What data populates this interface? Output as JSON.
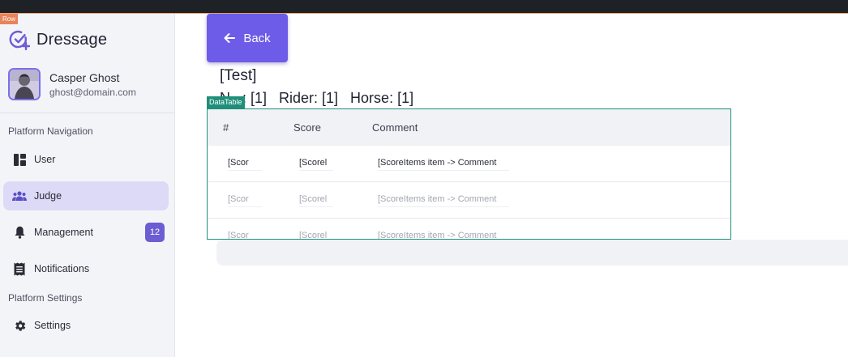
{
  "overlay_tags": {
    "row": "Row",
    "datatable": "DataTable"
  },
  "app": {
    "name": "Dressage",
    "logo_icon": "check-plus-circle-icon",
    "accent": "#6c5dd3"
  },
  "user": {
    "name": "Casper Ghost",
    "email": "ghost@domain.com"
  },
  "sidebar": {
    "sections": [
      {
        "title": "Platform Navigation",
        "items": [
          {
            "label": "User",
            "icon": "dashboard-icon",
            "active": false
          },
          {
            "label": "Judge",
            "icon": "people-icon",
            "active": true
          },
          {
            "label": "Management",
            "icon": "bell-icon",
            "badge": "12",
            "active": false
          },
          {
            "label": "Notifications",
            "icon": "receipt-icon",
            "active": false
          }
        ]
      },
      {
        "title": "Platform Settings",
        "items": [
          {
            "label": "Settings",
            "icon": "gear-icon",
            "active": false
          }
        ]
      }
    ]
  },
  "main": {
    "back_label": "Back",
    "test_title": "[Test]",
    "info_line": "N...: [1]   Rider: [1]   Horse: [1]"
  },
  "table": {
    "columns": [
      "#",
      "Score",
      "Comment"
    ],
    "rows": [
      [
        "[Scor",
        "[Scorel",
        "[ScoreItems item -> Comment"
      ],
      [
        "[Scor",
        "[Scorel",
        "[ScoreItems item -> Comment"
      ],
      [
        "[Scor",
        "[Scorel",
        "[ScoreItems item -> Comment"
      ]
    ]
  }
}
